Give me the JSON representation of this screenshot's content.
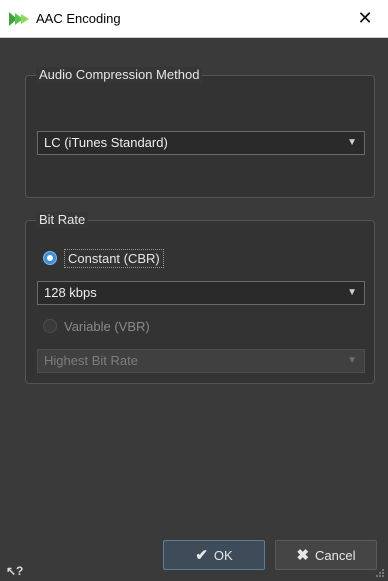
{
  "window": {
    "title": "AAC Encoding",
    "close_glyph": "✕"
  },
  "compression": {
    "group_title": "Audio Compression Method",
    "selected": "LC (iTunes Standard)"
  },
  "bitrate": {
    "group_title": "Bit Rate",
    "constant_label": "Constant (CBR)",
    "constant_checked": true,
    "constant_value": "128 kbps",
    "variable_label": "Variable (VBR)",
    "variable_checked": false,
    "variable_value": "Highest Bit Rate"
  },
  "buttons": {
    "ok_label": "OK",
    "cancel_label": "Cancel"
  },
  "icons": {
    "app": "app-logo-icon",
    "close": "close-icon",
    "dropdown": "chevron-down-icon",
    "ok": "checkmark-icon",
    "cancel": "x-icon",
    "help": "help-icon",
    "resize": "resize-grip-icon"
  },
  "colors": {
    "accent": "#3d8fd6",
    "window_bg": "#3a3a3a",
    "titlebar_bg": "#ffffff"
  }
}
